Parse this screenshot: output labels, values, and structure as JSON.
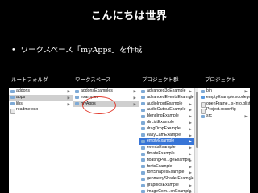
{
  "slide": {
    "title": "こんにちは世界",
    "bullet": "•",
    "bullet_text": "ワークスペース「myApps」を作成"
  },
  "column_labels": [
    "ルートフォルダ",
    "ワークスペース",
    "プロジェクト群",
    "プロジェクト"
  ],
  "finder": {
    "col1": [
      {
        "label": "addons",
        "type": "folder",
        "arrow": true
      },
      {
        "label": "apps",
        "type": "folder",
        "arrow": true,
        "selected": "grey"
      },
      {
        "label": "libs",
        "type": "folder",
        "arrow": true
      },
      {
        "label": "readme.osx",
        "type": "file",
        "arrow": false
      }
    ],
    "col2": [
      {
        "label": "addonsExamples",
        "type": "folder",
        "arrow": true
      },
      {
        "label": "examples",
        "type": "folder",
        "arrow": true
      },
      {
        "label": "myApps",
        "type": "folder",
        "arrow": true,
        "selected": "grey"
      }
    ],
    "col3": [
      {
        "label": "advanced3dExample",
        "type": "folder",
        "arrow": true
      },
      {
        "label": "advancedEventsExample",
        "type": "folder",
        "arrow": true
      },
      {
        "label": "audioInputExample",
        "type": "folder",
        "arrow": true
      },
      {
        "label": "audioOutputExample",
        "type": "folder",
        "arrow": true
      },
      {
        "label": "blendingExample",
        "type": "folder",
        "arrow": true
      },
      {
        "label": "dirListExample",
        "type": "folder",
        "arrow": true
      },
      {
        "label": "dragDropExample",
        "type": "folder",
        "arrow": true
      },
      {
        "label": "easyCamExample",
        "type": "folder",
        "arrow": true
      },
      {
        "label": "emptyExample",
        "type": "folder",
        "arrow": true,
        "selected": "blue"
      },
      {
        "label": "eventsExample",
        "type": "folder",
        "arrow": true
      },
      {
        "label": "fImateExample",
        "type": "folder",
        "arrow": true
      },
      {
        "label": "floatingPoi...geExample",
        "type": "folder",
        "arrow": true
      },
      {
        "label": "fontsExample",
        "type": "folder",
        "arrow": true
      },
      {
        "label": "fontShapesExample",
        "type": "folder",
        "arrow": true
      },
      {
        "label": "geometryShaderExample",
        "type": "folder",
        "arrow": true
      },
      {
        "label": "graphicsExample",
        "type": "folder",
        "arrow": true
      },
      {
        "label": "imageCom...onExample",
        "type": "folder",
        "arrow": true
      }
    ],
    "col4": [
      {
        "label": "bin",
        "type": "folder",
        "arrow": true
      },
      {
        "label": "emptyExample.xcodeproj",
        "type": "proj",
        "arrow": false
      },
      {
        "label": "openFrame...s-Info.plist",
        "type": "file",
        "arrow": false
      },
      {
        "label": "Project.xcconfig",
        "type": "file",
        "arrow": false
      },
      {
        "label": "src",
        "type": "folder",
        "arrow": true
      }
    ]
  },
  "colors": {
    "background": "#000000",
    "selection": "#3875d7",
    "highlight_circle": "#e23b2e"
  }
}
